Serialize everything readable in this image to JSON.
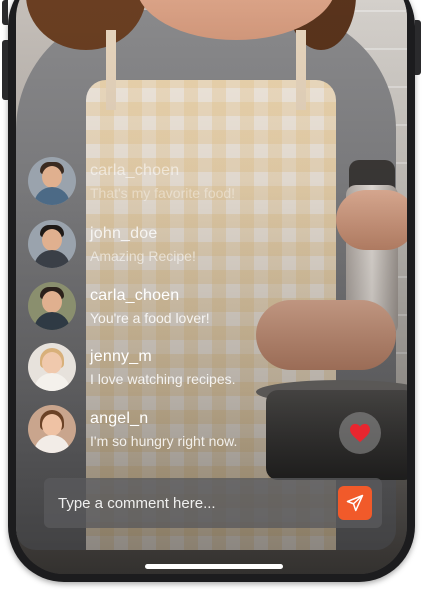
{
  "comments": [
    {
      "username": "carla_choen",
      "message": "That's my favorite food!"
    },
    {
      "username": "john_doe",
      "message": "Amazing Recipe!"
    },
    {
      "username": "carla_choen",
      "message": "You're a food lover!"
    },
    {
      "username": "jenny_m",
      "message": "I love watching recipes."
    },
    {
      "username": "angel_n",
      "message": "I'm so hungry right now."
    }
  ],
  "comment_input": {
    "placeholder": "Type a comment here..."
  },
  "colors": {
    "send_button": "#f15a2a",
    "heart": "#e8262f"
  },
  "icons": {
    "like": "heart-icon",
    "send": "send-icon"
  }
}
